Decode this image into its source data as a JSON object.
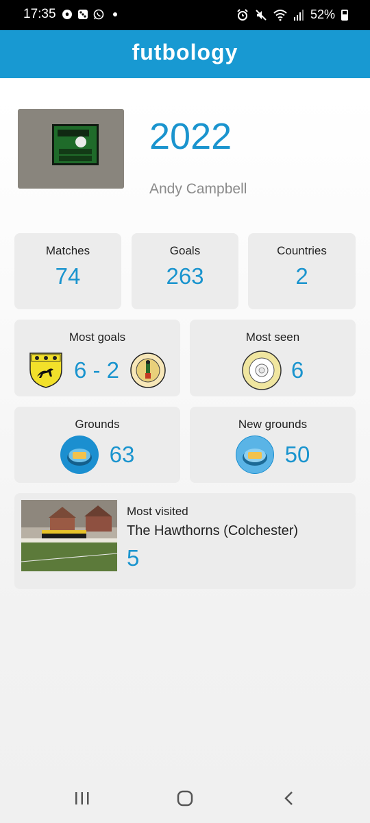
{
  "status_bar": {
    "time": "17:35",
    "battery": "52%"
  },
  "app": {
    "brand": "futbology"
  },
  "profile": {
    "year": "2022",
    "user_name": "Andy Campbell"
  },
  "stats": [
    {
      "label": "Matches",
      "value": "74"
    },
    {
      "label": "Goals",
      "value": "263"
    },
    {
      "label": "Countries",
      "value": "2"
    }
  ],
  "most_goals": {
    "label": "Most goals",
    "score": "6 - 2"
  },
  "most_seen": {
    "label": "Most seen",
    "value": "6"
  },
  "grounds": {
    "label": "Grounds",
    "value": "63"
  },
  "new_grounds": {
    "label": "New grounds",
    "value": "50"
  },
  "most_visited": {
    "label": "Most visited",
    "ground": "The Hawthorns (Colchester)",
    "value": "5"
  },
  "colors": {
    "brand_blue": "#1899d2",
    "value_blue": "#1a94ce",
    "card_bg": "#ececec"
  }
}
